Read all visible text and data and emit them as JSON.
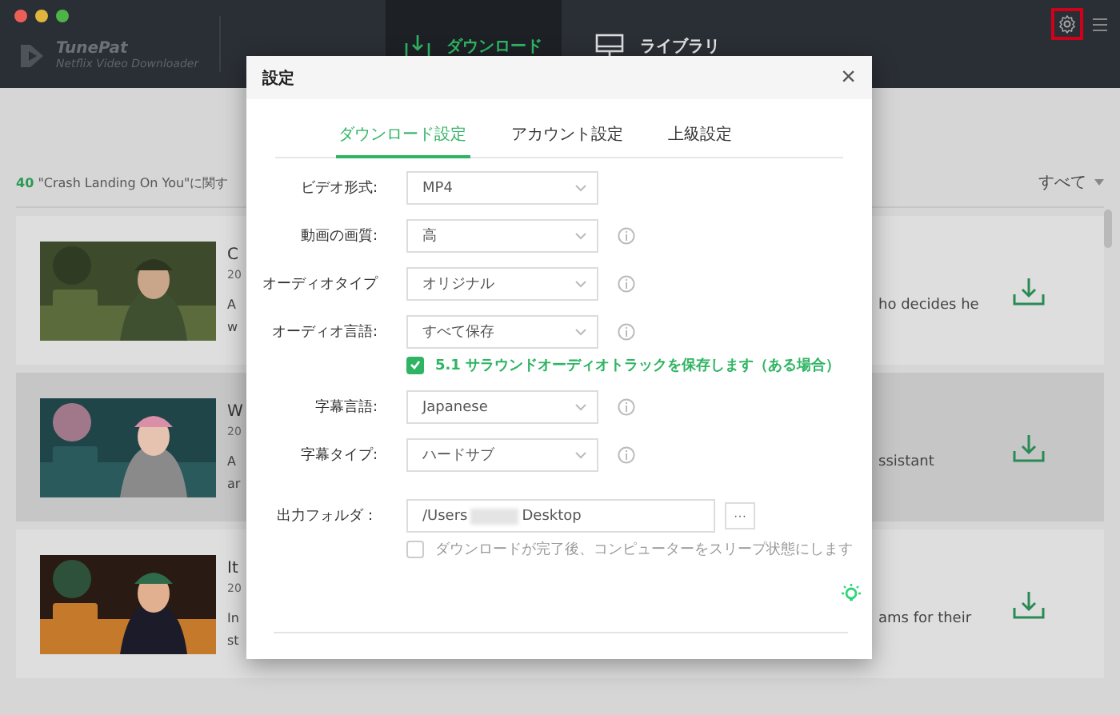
{
  "app": {
    "name": "TunePat",
    "subtitle": "Netflix Video Downloader"
  },
  "nav_tabs": [
    {
      "label": "ダウンロード",
      "kind": "download",
      "selected": true
    },
    {
      "label": "ライブラリ",
      "kind": "library",
      "selected": false
    }
  ],
  "results": {
    "count": "40",
    "query": "\"Crash Landing On You\"に関す",
    "filter": "すべて"
  },
  "videos": [
    {
      "title": "C",
      "year": "20",
      "desc_left": [
        "A",
        "w"
      ],
      "desc_right": "ho decides he",
      "highlighted": false
    },
    {
      "title": "W",
      "year": "20",
      "desc_left": [
        "A",
        "ar"
      ],
      "desc_right": "ssistant",
      "highlighted": true
    },
    {
      "title": "It",
      "year": "20",
      "desc_left": [
        "In",
        "st"
      ],
      "desc_right": "ams for their",
      "highlighted": false
    }
  ],
  "dialog": {
    "title": "設定",
    "close": "×",
    "tabs": [
      {
        "label": "ダウンロード設定",
        "selected": true
      },
      {
        "label": "アカウント設定",
        "selected": false
      },
      {
        "label": "上級設定",
        "selected": false
      }
    ],
    "settings": [
      {
        "kind": "select",
        "label": "ビデオ形式:",
        "value": "MP4",
        "info": false
      },
      {
        "kind": "select",
        "label": "動画の画質:",
        "value": "高",
        "info": true
      },
      {
        "kind": "select",
        "label": "オーディオタイプ",
        "value": "オリジナル",
        "info": true
      },
      {
        "kind": "select",
        "label": "オーディオ言語:",
        "value": "すべて保存",
        "info": true
      },
      {
        "kind": "checkbox",
        "label": "5.1 サラウンドオーディオトラックを保存します（ある場合）",
        "checked": true
      },
      {
        "kind": "select",
        "label": "字幕言語:",
        "value": "Japanese",
        "info": true
      },
      {
        "kind": "select",
        "label": "字幕タイプ:",
        "value": "ハードサブ",
        "info": true
      },
      {
        "kind": "folder",
        "label": "出力フォルダ：",
        "value_start": "/Users",
        "value_end": "Desktop",
        "button": "···"
      },
      {
        "kind": "checkbox",
        "label": "ダウンロードが完了後、コンピューターをスリープ状態にします",
        "checked": false
      }
    ]
  }
}
